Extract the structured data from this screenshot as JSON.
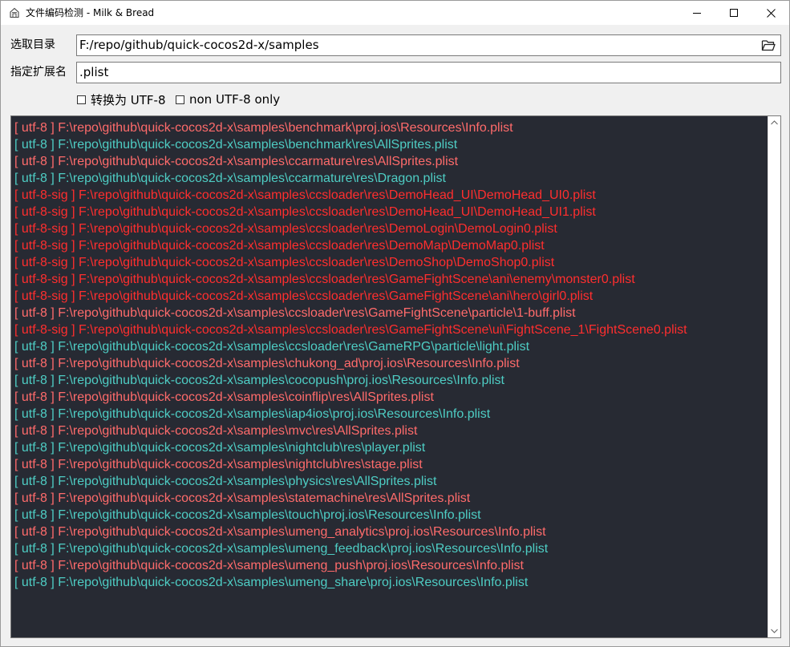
{
  "window": {
    "title": "文件编码检测 - Milk & Bread"
  },
  "form": {
    "dir_label": "选取目录",
    "dir_value": "F:/repo/github/quick-cocos2d-x/samples",
    "ext_label": "指定扩展名",
    "ext_value": ".plist",
    "convert_label": "转换为 UTF-8",
    "non_utf8_label": "non UTF-8 only"
  },
  "colors": {
    "utf8_tag_color": "#4ecdc4",
    "utf8sig_tag_color": "#ff2e2e",
    "alt_color": "#ff6b6b",
    "log_background": "#272a33"
  },
  "log": [
    {
      "text": "[ utf-8 ] F:\\repo\\github\\quick-cocos2d-x\\samples\\benchmark\\proj.ios\\Resources\\Info.plist",
      "color": "#ff6b6b"
    },
    {
      "text": "[ utf-8 ] F:\\repo\\github\\quick-cocos2d-x\\samples\\benchmark\\res\\AllSprites.plist",
      "color": "#4ecdc4"
    },
    {
      "text": "[ utf-8 ] F:\\repo\\github\\quick-cocos2d-x\\samples\\ccarmature\\res\\AllSprites.plist",
      "color": "#ff6b6b"
    },
    {
      "text": "[ utf-8 ] F:\\repo\\github\\quick-cocos2d-x\\samples\\ccarmature\\res\\Dragon.plist",
      "color": "#4ecdc4"
    },
    {
      "text": "[ utf-8-sig ] F:\\repo\\github\\quick-cocos2d-x\\samples\\ccsloader\\res\\DemoHead_UI\\DemoHead_UI0.plist",
      "color": "#ff2e2e"
    },
    {
      "text": "[ utf-8-sig ] F:\\repo\\github\\quick-cocos2d-x\\samples\\ccsloader\\res\\DemoHead_UI\\DemoHead_UI1.plist",
      "color": "#ff2e2e"
    },
    {
      "text": "[ utf-8-sig ] F:\\repo\\github\\quick-cocos2d-x\\samples\\ccsloader\\res\\DemoLogin\\DemoLogin0.plist",
      "color": "#ff2e2e"
    },
    {
      "text": "[ utf-8-sig ] F:\\repo\\github\\quick-cocos2d-x\\samples\\ccsloader\\res\\DemoMap\\DemoMap0.plist",
      "color": "#ff2e2e"
    },
    {
      "text": "[ utf-8-sig ] F:\\repo\\github\\quick-cocos2d-x\\samples\\ccsloader\\res\\DemoShop\\DemoShop0.plist",
      "color": "#ff2e2e"
    },
    {
      "text": "[ utf-8-sig ] F:\\repo\\github\\quick-cocos2d-x\\samples\\ccsloader\\res\\GameFightScene\\ani\\enemy\\monster0.plist",
      "color": "#ff2e2e"
    },
    {
      "text": "[ utf-8-sig ] F:\\repo\\github\\quick-cocos2d-x\\samples\\ccsloader\\res\\GameFightScene\\ani\\hero\\girl0.plist",
      "color": "#ff2e2e"
    },
    {
      "text": "[ utf-8 ] F:\\repo\\github\\quick-cocos2d-x\\samples\\ccsloader\\res\\GameFightScene\\particle\\1-buff.plist",
      "color": "#ff6b6b"
    },
    {
      "text": "[ utf-8-sig ] F:\\repo\\github\\quick-cocos2d-x\\samples\\ccsloader\\res\\GameFightScene\\ui\\FightScene_1\\FightScene0.plist",
      "color": "#ff2e2e"
    },
    {
      "text": "[ utf-8 ] F:\\repo\\github\\quick-cocos2d-x\\samples\\ccsloader\\res\\GameRPG\\particle\\light.plist",
      "color": "#4ecdc4"
    },
    {
      "text": "[ utf-8 ] F:\\repo\\github\\quick-cocos2d-x\\samples\\chukong_ad\\proj.ios\\Resources\\Info.plist",
      "color": "#ff6b6b"
    },
    {
      "text": "[ utf-8 ] F:\\repo\\github\\quick-cocos2d-x\\samples\\cocopush\\proj.ios\\Resources\\Info.plist",
      "color": "#4ecdc4"
    },
    {
      "text": "[ utf-8 ] F:\\repo\\github\\quick-cocos2d-x\\samples\\coinflip\\res\\AllSprites.plist",
      "color": "#ff6b6b"
    },
    {
      "text": "[ utf-8 ] F:\\repo\\github\\quick-cocos2d-x\\samples\\iap4ios\\proj.ios\\Resources\\Info.plist",
      "color": "#4ecdc4"
    },
    {
      "text": "[ utf-8 ] F:\\repo\\github\\quick-cocos2d-x\\samples\\mvc\\res\\AllSprites.plist",
      "color": "#ff6b6b"
    },
    {
      "text": "[ utf-8 ] F:\\repo\\github\\quick-cocos2d-x\\samples\\nightclub\\res\\player.plist",
      "color": "#4ecdc4"
    },
    {
      "text": "[ utf-8 ] F:\\repo\\github\\quick-cocos2d-x\\samples\\nightclub\\res\\stage.plist",
      "color": "#ff6b6b"
    },
    {
      "text": "[ utf-8 ] F:\\repo\\github\\quick-cocos2d-x\\samples\\physics\\res\\AllSprites.plist",
      "color": "#4ecdc4"
    },
    {
      "text": "[ utf-8 ] F:\\repo\\github\\quick-cocos2d-x\\samples\\statemachine\\res\\AllSprites.plist",
      "color": "#ff6b6b"
    },
    {
      "text": "[ utf-8 ] F:\\repo\\github\\quick-cocos2d-x\\samples\\touch\\proj.ios\\Resources\\Info.plist",
      "color": "#4ecdc4"
    },
    {
      "text": "[ utf-8 ] F:\\repo\\github\\quick-cocos2d-x\\samples\\umeng_analytics\\proj.ios\\Resources\\Info.plist",
      "color": "#ff6b6b"
    },
    {
      "text": "[ utf-8 ] F:\\repo\\github\\quick-cocos2d-x\\samples\\umeng_feedback\\proj.ios\\Resources\\Info.plist",
      "color": "#4ecdc4"
    },
    {
      "text": "[ utf-8 ] F:\\repo\\github\\quick-cocos2d-x\\samples\\umeng_push\\proj.ios\\Resources\\Info.plist",
      "color": "#ff6b6b"
    },
    {
      "text": "[ utf-8 ] F:\\repo\\github\\quick-cocos2d-x\\samples\\umeng_share\\proj.ios\\Resources\\Info.plist",
      "color": "#4ecdc4"
    }
  ]
}
